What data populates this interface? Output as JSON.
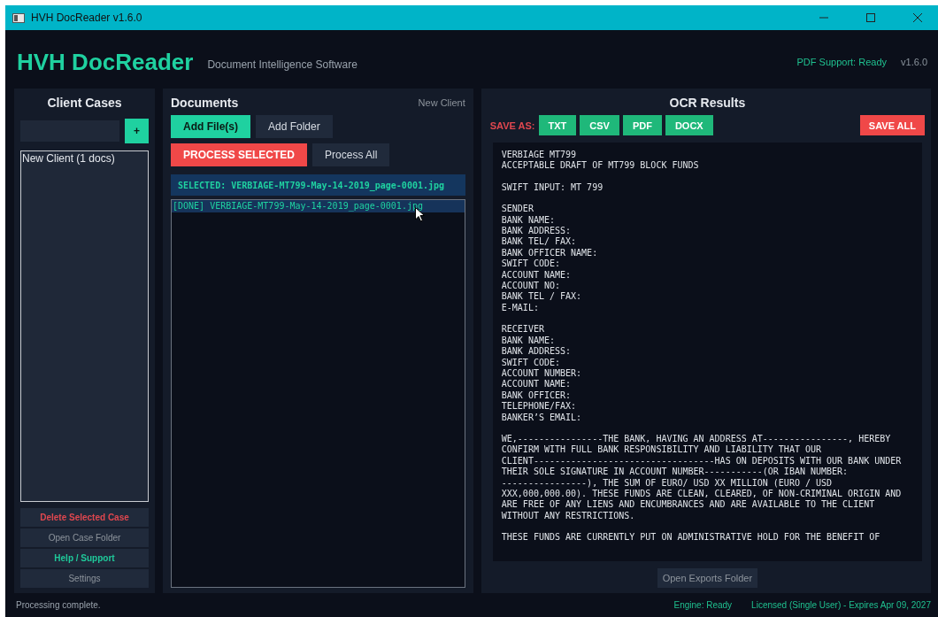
{
  "window": {
    "title": "HVH DocReader v1.6.0"
  },
  "header": {
    "app_name": "HVH DocReader",
    "tagline": "Document Intelligence Software",
    "pdf_status": "PDF Support: Ready",
    "version": "v1.6.0"
  },
  "client_cases": {
    "title": "Client Cases",
    "add_button": "+",
    "items": [
      {
        "label": "New Client  (1 docs)",
        "selected": false
      }
    ],
    "actions": [
      {
        "label": "Delete Selected Case",
        "kind": "danger"
      },
      {
        "label": "Open Case Folder",
        "kind": "muted"
      },
      {
        "label": "Help / Support",
        "kind": "accent"
      },
      {
        "label": "Settings",
        "kind": "muted"
      }
    ]
  },
  "documents": {
    "title": "Documents",
    "client": "New Client",
    "buttons": [
      [
        {
          "label": "Add File(s)",
          "kind": "primary"
        },
        {
          "label": "Add Folder",
          "kind": "secondary"
        }
      ],
      [
        {
          "label": "PROCESS SELECTED",
          "kind": "danger"
        },
        {
          "label": "Process All",
          "kind": "secondary"
        }
      ]
    ],
    "selected_banner": "SELECTED:  VERBIAGE-MT799-May-14-2019_page-0001.jpg",
    "files": [
      {
        "label": "[DONE]  VERBIAGE-MT799-May-14-2019_page-0001.jpg",
        "selected": true
      }
    ]
  },
  "ocr": {
    "title": "OCR Results",
    "save_as_label": "SAVE AS:",
    "formats": [
      "TXT",
      "CSV",
      "PDF",
      "DOCX"
    ],
    "save_all": "SAVE ALL",
    "text_blocks": [
      [
        "VERBIAGE MT799",
        "ACCEPTABLE DRAFT OF MT799 BLOCK FUNDS"
      ],
      [
        "SWIFT INPUT: MT 799"
      ],
      [
        "SENDER",
        "BANK NAME:",
        "BANK ADDRESS:",
        "BANK TEL/ FAX:",
        "BANK OFFICER NAME:",
        "SWIFT CODE:",
        "ACCOUNT NAME:",
        "ACCOUNT NO:",
        "BANK TEL / FAX:",
        "E-MAIL:"
      ],
      [
        "RECEIVER",
        "BANK NAME:",
        "BANK ADDRESS:",
        "SWIFT CODE:",
        "ACCOUNT NUMBER:",
        "ACCOUNT NAME:",
        "BANK OFFICER:",
        "TELEPHONE/FAX:",
        "BANKER’S EMAIL:"
      ],
      [
        "WE,----------------THE BANK, HAVING AN ADDRESS AT----------------, HEREBY",
        "CONFIRM WITH FULL BANK RESPONSIBILITY AND LIABILITY THAT OUR",
        "CLIENT----------------------------------HAS ON DEPOSITS WITH OUR BANK UNDER",
        "THEIR SOLE SIGNATURE IN ACCOUNT NUMBER-----------(OR IBAN NUMBER:",
        "----------------), THE SUM OF EURO/ USD XX MILLION (EURO / USD",
        "XXX,000,000.00). THESE FUNDS ARE CLEAN, CLEARED, OF NON-CRIMINAL ORIGIN AND",
        "ARE FREE OF ANY LIENS AND ENCUMBRANCES AND ARE AVAILABLE TO THE CLIENT",
        "WITHOUT ANY RESTRICTIONS."
      ],
      [
        "THESE FUNDS ARE CURRENTLY PUT ON ADMINISTRATIVE HOLD FOR THE BENEFIT OF"
      ]
    ],
    "open_exports": "Open Exports Folder"
  },
  "status_bar": {
    "message": "Processing complete.",
    "engine": "Engine: Ready",
    "license": "Licensed (Single User) - Expires Apr 09, 2027"
  }
}
